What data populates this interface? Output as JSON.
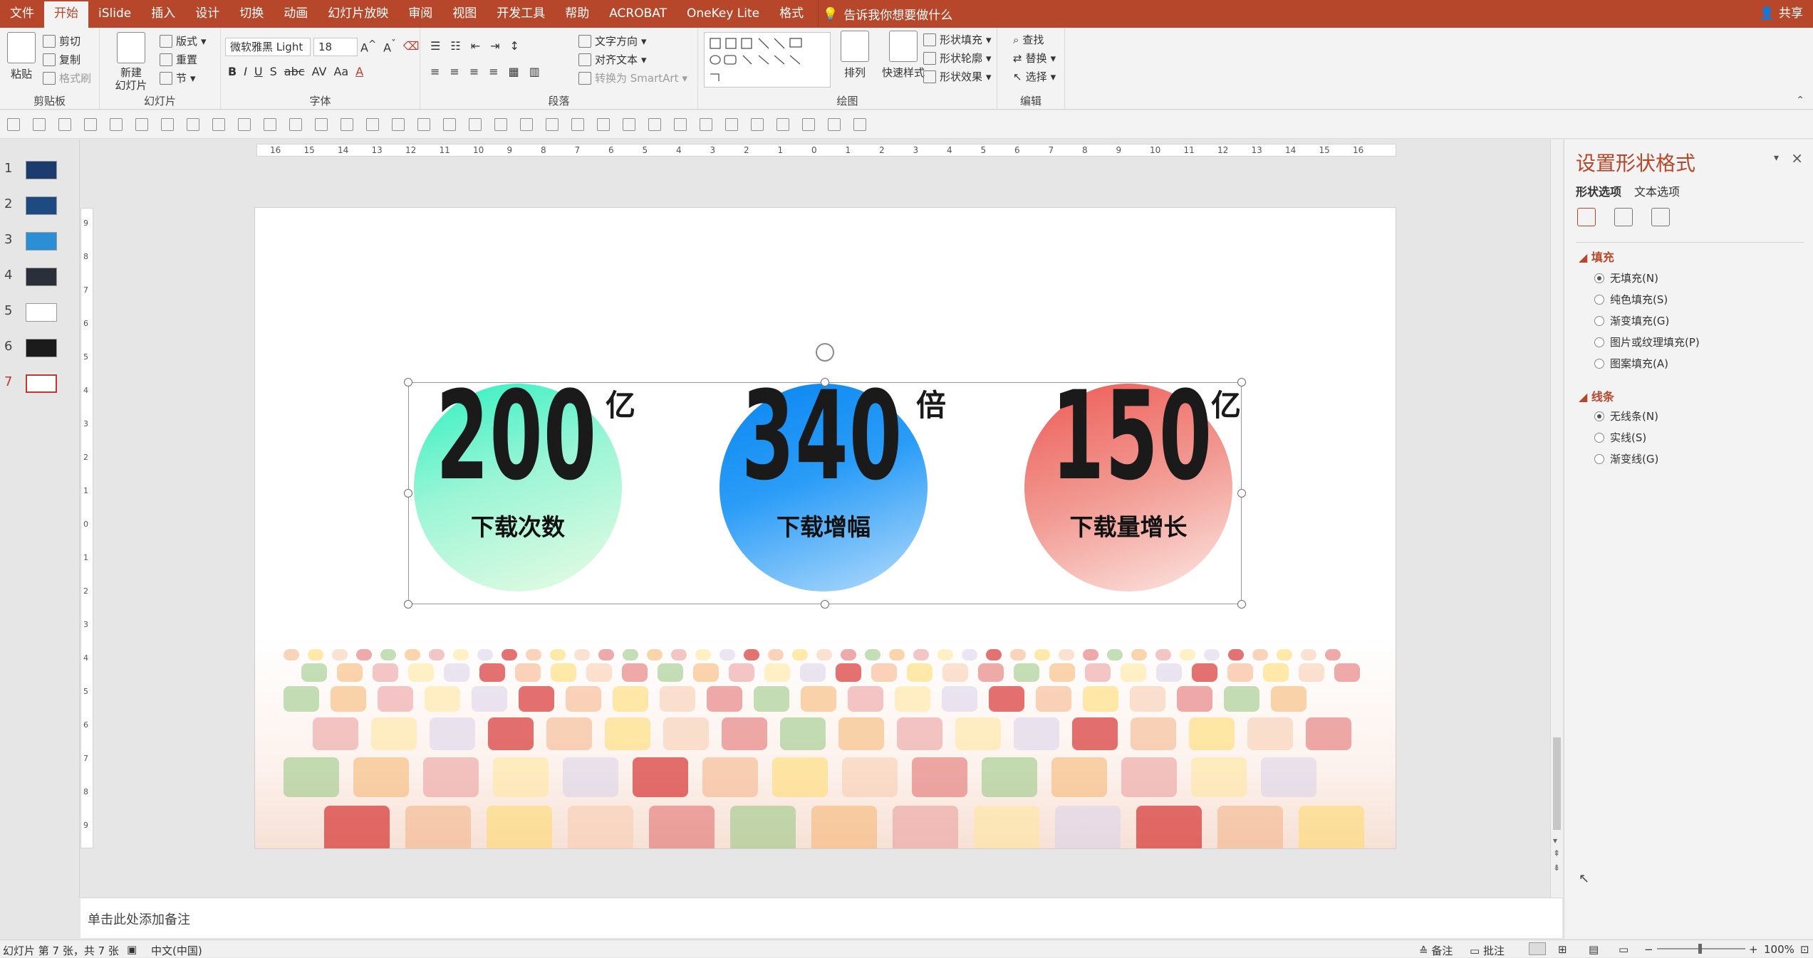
{
  "menu": {
    "items": [
      "文件",
      "开始",
      "iSlide",
      "插入",
      "设计",
      "切换",
      "动画",
      "幻灯片放映",
      "审阅",
      "视图",
      "开发工具",
      "帮助",
      "ACROBAT",
      "OneKey Lite",
      "格式"
    ],
    "active_index": 1,
    "tell_me": "告诉我你想要做什么",
    "share": "共享"
  },
  "ribbon": {
    "clipboard": {
      "label": "剪贴板",
      "paste": "粘贴",
      "cut": "剪切",
      "copy": "复制",
      "format_painter": "格式刷"
    },
    "slides": {
      "label": "幻灯片",
      "new_slide": "新建\n幻灯片",
      "layout": "版式",
      "reset": "重置",
      "section": "节"
    },
    "font": {
      "label": "字体",
      "font_name": "微软雅黑 Light",
      "font_size": "18"
    },
    "paragraph": {
      "label": "段落",
      "text_direction": "文字方向",
      "align_text": "对齐文本",
      "convert_smartart": "转换为 SmartArt"
    },
    "drawing": {
      "label": "绘图",
      "arrange": "排列",
      "quick_styles": "快速样式",
      "shape_fill": "形状填充",
      "shape_outline": "形状轮廓",
      "shape_effects": "形状效果"
    },
    "editing": {
      "label": "编辑",
      "find": "查找",
      "replace": "替换",
      "select": "选择"
    }
  },
  "thumbnails": {
    "numbers": [
      "1",
      "2",
      "3",
      "4",
      "5",
      "6",
      "7"
    ],
    "active_index": 6
  },
  "ruler": {
    "h_ticks": [
      "16",
      "15",
      "14",
      "13",
      "12",
      "11",
      "10",
      "9",
      "8",
      "7",
      "6",
      "5",
      "4",
      "3",
      "2",
      "1",
      "0",
      "1",
      "2",
      "3",
      "4",
      "5",
      "6",
      "7",
      "8",
      "9",
      "10",
      "11",
      "12",
      "13",
      "14",
      "15",
      "16"
    ],
    "v_ticks": [
      "9",
      "8",
      "7",
      "6",
      "5",
      "4",
      "3",
      "2",
      "1",
      "0",
      "1",
      "2",
      "3",
      "4",
      "5",
      "6",
      "7",
      "8",
      "9"
    ]
  },
  "slide": {
    "stats": [
      {
        "number": "200",
        "unit": "亿",
        "label": "下载次数"
      },
      {
        "number": "340",
        "unit": "倍",
        "label": "下载增幅"
      },
      {
        "number": "150",
        "unit": "亿",
        "label": "下载量增长"
      }
    ]
  },
  "notes_placeholder": "单击此处添加备注",
  "status": {
    "slide_info": "幻灯片 第 7 张，共 7 张",
    "language": "中文(中国)",
    "notes": "备注",
    "comments": "批注",
    "zoom": "100%"
  },
  "format_pane": {
    "title": "设置形状格式",
    "tabs": [
      "形状选项",
      "文本选项"
    ],
    "fill_section": "填充",
    "fill_options": [
      "无填充(N)",
      "纯色填充(S)",
      "渐变填充(G)",
      "图片或纹理填充(P)",
      "图案填充(A)"
    ],
    "fill_selected": 0,
    "line_section": "线条",
    "line_options": [
      "无线条(N)",
      "实线(S)",
      "渐变线(G)"
    ],
    "line_selected": 0
  },
  "colors": {
    "accent": "#b7472a"
  }
}
